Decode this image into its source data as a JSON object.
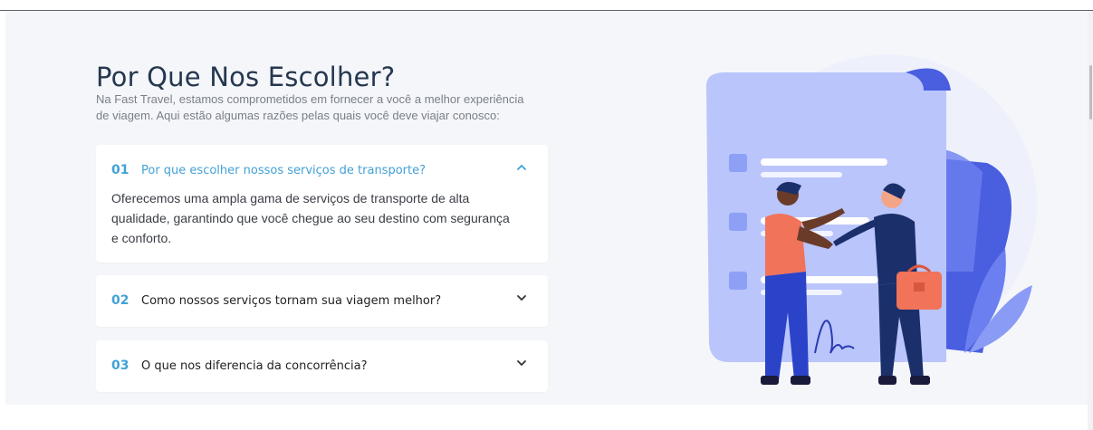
{
  "section": {
    "title": "Por Que Nos Escolher?",
    "intro": "Na Fast Travel, estamos comprometidos em fornecer a você a melhor experiência de viagem. Aqui estão algumas razões pelas quais você deve viajar conosco:"
  },
  "faq": [
    {
      "number": "01",
      "question": "Por que escolher nossos serviços de transporte?",
      "answer": "Oferecemos uma ampla gama de serviços de transporte de alta qualidade, garantindo que você chegue ao seu destino com segurança e conforto.",
      "open": true,
      "icon": "chevron-up-icon"
    },
    {
      "number": "02",
      "question": "Como nossos serviços tornam sua viagem melhor?",
      "open": false,
      "icon": "chevron-down-icon"
    },
    {
      "number": "03",
      "question": "O que nos diferencia da concorrência?",
      "open": false,
      "icon": "chevron-down-icon"
    }
  ],
  "colors": {
    "accent": "#43a1d6",
    "heading": "#26374f",
    "section_bg": "#f4f6fa"
  },
  "illustration": {
    "icon": "handshake-contract-illustration"
  }
}
